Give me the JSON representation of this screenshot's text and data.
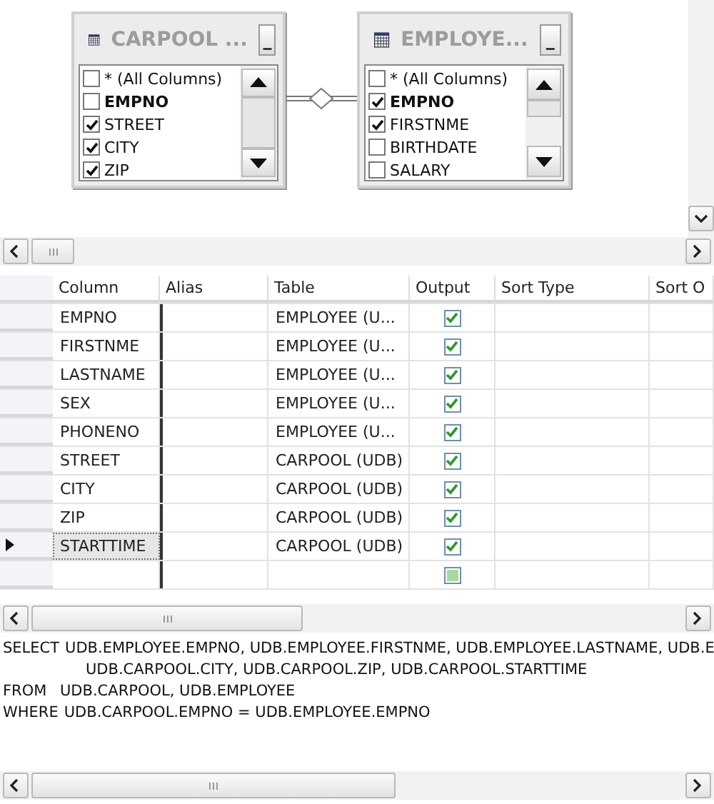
{
  "diagram": {
    "tables": [
      {
        "title": "CARPOOL ...",
        "minimize": "_",
        "columns": [
          {
            "name": "* (All Columns)",
            "checked": false,
            "key": false
          },
          {
            "name": "EMPNO",
            "checked": false,
            "key": true
          },
          {
            "name": "STREET",
            "checked": true,
            "key": false
          },
          {
            "name": "CITY",
            "checked": true,
            "key": false
          },
          {
            "name": "ZIP",
            "checked": true,
            "key": false
          }
        ]
      },
      {
        "title": "EMPLOYE...",
        "minimize": "_",
        "columns": [
          {
            "name": "* (All Columns)",
            "checked": false,
            "key": false
          },
          {
            "name": "EMPNO",
            "checked": true,
            "key": true
          },
          {
            "name": "FIRSTNME",
            "checked": true,
            "key": false
          },
          {
            "name": "BIRTHDATE",
            "checked": false,
            "key": false
          },
          {
            "name": "SALARY",
            "checked": false,
            "key": false
          }
        ]
      }
    ]
  },
  "grid": {
    "columns": [
      "Column",
      "Alias",
      "Table",
      "Output",
      "Sort Type",
      "Sort O"
    ],
    "rows": [
      {
        "column": "EMPNO",
        "table": "EMPLOYEE (U...",
        "output": true,
        "selected": false
      },
      {
        "column": "FIRSTNME",
        "table": "EMPLOYEE (U...",
        "output": true,
        "selected": false
      },
      {
        "column": "LASTNAME",
        "table": "EMPLOYEE (U...",
        "output": true,
        "selected": false
      },
      {
        "column": "SEX",
        "table": "EMPLOYEE (U...",
        "output": true,
        "selected": false
      },
      {
        "column": "PHONENO",
        "table": "EMPLOYEE (U...",
        "output": true,
        "selected": false
      },
      {
        "column": "STREET",
        "table": "CARPOOL (UDB)",
        "output": true,
        "selected": false
      },
      {
        "column": "CITY",
        "table": "CARPOOL (UDB)",
        "output": true,
        "selected": false
      },
      {
        "column": "ZIP",
        "table": "CARPOOL (UDB)",
        "output": true,
        "selected": false
      },
      {
        "column": "STARTTIME",
        "table": "CARPOOL (UDB)",
        "output": true,
        "selected": true
      },
      {
        "kind": "new_row",
        "selected": false
      }
    ]
  },
  "sql": {
    "lines": [
      {
        "kind": "clause",
        "keyword": "SELECT",
        "text": "UDB.EMPLOYEE.EMPNO, UDB.EMPLOYEE.FIRSTNME, UDB.EMPLOYEE.LASTNAME, UDB.E"
      },
      {
        "kind": "continuation",
        "text": "UDB.CARPOOL.CITY, UDB.CARPOOL.ZIP, UDB.CARPOOL.STARTTIME"
      },
      {
        "kind": "clause",
        "keyword": "FROM",
        "text": "UDB.CARPOOL, UDB.EMPLOYEE"
      },
      {
        "kind": "clause",
        "keyword": "WHERE",
        "text": "UDB.CARPOOL.EMPNO = UDB.EMPLOYEE.EMPNO"
      }
    ]
  }
}
